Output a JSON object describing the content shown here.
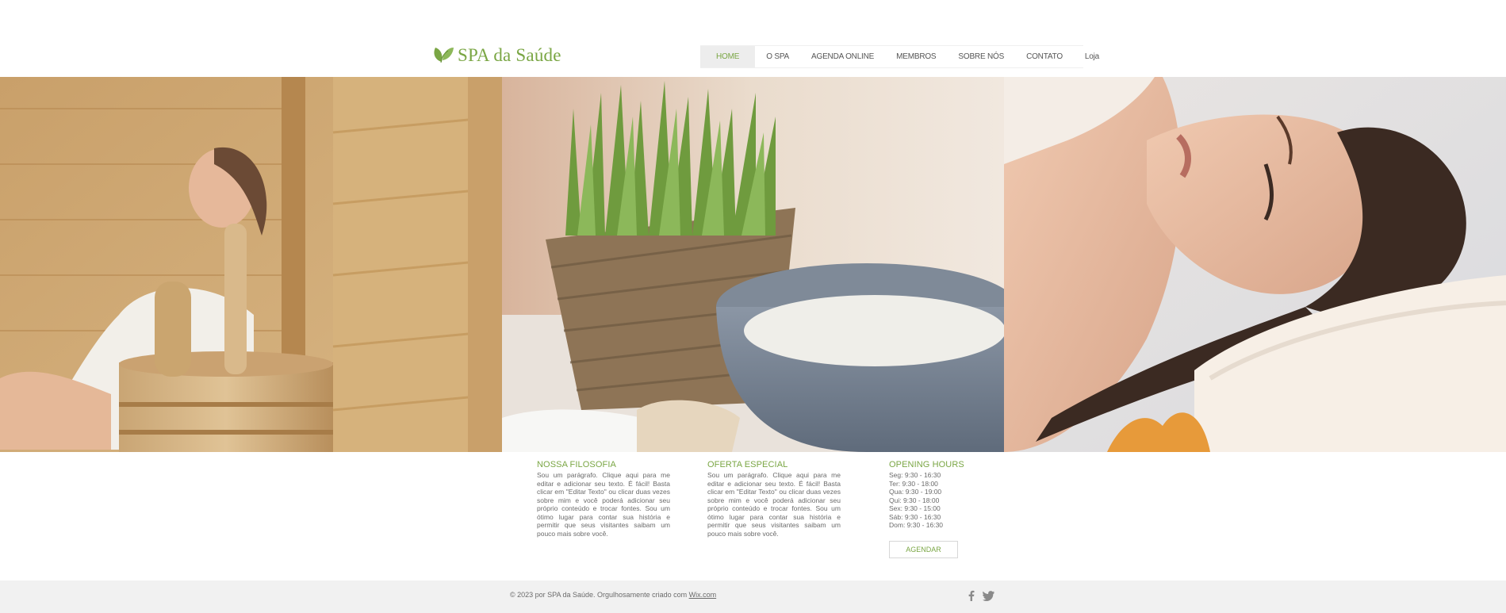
{
  "brand": {
    "name": "SPA da Saúde",
    "accent_color": "#7aa644",
    "logo_icon": "leaf-icon"
  },
  "nav": {
    "items": [
      {
        "label": "HOME",
        "active": true
      },
      {
        "label": "O SPA",
        "active": false
      },
      {
        "label": "AGENDA ONLINE",
        "active": false
      },
      {
        "label": "MEMBROS",
        "active": false
      },
      {
        "label": "SOBRE NÓS",
        "active": false
      },
      {
        "label": "CONTATO",
        "active": false
      },
      {
        "label": "Loja",
        "active": false
      }
    ]
  },
  "hero": {
    "images": [
      "sauna-image",
      "wheatgrass-bowl-image",
      "relaxing-woman-image"
    ]
  },
  "columns": {
    "philosophy": {
      "title": "NOSSA FILOSOFIA",
      "text": "Sou um parágrafo. Clique aqui para me editar e adicionar seu texto. É fácil! Basta clicar em \"Editar Texto\" ou clicar duas vezes sobre mim e você poderá adicionar seu próprio conteúdo e trocar fontes. Sou um ótimo lugar para contar sua história e permitir que seus visitantes saibam um pouco mais sobre você."
    },
    "offer": {
      "title": "OFERTA ESPECIAL",
      "text": "Sou um parágrafo. Clique aqui para me editar e adicionar seu texto. É fácil! Basta clicar em \"Editar Texto\" ou clicar duas vezes sobre mim e você poderá adicionar seu próprio conteúdo e trocar fontes. Sou um ótimo lugar para contar sua história e permitir que seus visitantes saibam um pouco mais sobre você."
    },
    "hours": {
      "title": "OPENING HOURS",
      "lines": [
        "Seg: 9:30 - 16:30",
        "Ter: 9:30 - 18:00",
        "Qua: 9:30 - 19:00",
        "Qui: 9:30 - 18:00",
        "Sex: 9:30 - 15:00",
        "Sáb: 9:30 - 16:30",
        "Dom: 9:30 - 16:30"
      ],
      "button_label": "AGENDAR"
    }
  },
  "footer": {
    "copyright": "© 2023 por SPA da Saúde.  Orgulhosamente criado com",
    "link_label": "Wix.com",
    "social_icons": [
      "facebook-icon",
      "twitter-icon"
    ]
  }
}
